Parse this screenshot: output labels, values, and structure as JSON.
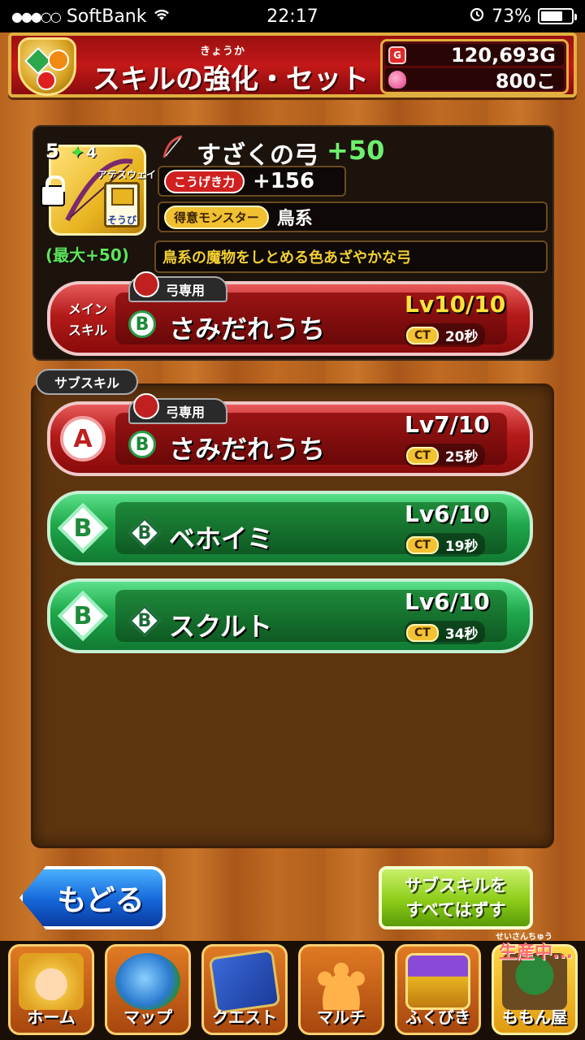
{
  "status_bar": {
    "carrier": "SoftBank",
    "time": "22:17",
    "battery": "73%",
    "battery_level": 0.73
  },
  "header": {
    "title": "スキルの強化・セット",
    "ruby": "きょうか",
    "gold": "120,693G",
    "gold_icon": "G",
    "gems": "800こ"
  },
  "item": {
    "rarity": "5",
    "plus_count": "4",
    "character": "アテスウェイ",
    "equip_label": "そうび",
    "max_plus": "(最大+50)",
    "name": "すざくの弓",
    "plus": "+50",
    "attack_label": "こうげき力",
    "attack_value": "+156",
    "monster_label": "得意モンスター",
    "monster_value": "鳥系",
    "description": "鳥系の魔物をしとめる色あざやかな弓"
  },
  "main_skill": {
    "slot_label_1": "メイン",
    "slot_label_2": "スキル",
    "tag": "弓専用",
    "rank": "B",
    "name": "さみだれうち",
    "level": "Lv10/10",
    "ct_label": "CT",
    "ct_value": "20秒"
  },
  "sub_skills": {
    "label": "サブスキル",
    "items": [
      {
        "slot": "A",
        "tag": "弓専用",
        "rank": "B",
        "name": "さみだれうち",
        "level": "Lv7/10",
        "ct_label": "CT",
        "ct_value": "25秒",
        "color": "red"
      },
      {
        "slot": "B",
        "tag": "",
        "rank": "B",
        "name": "ベホイミ",
        "level": "Lv6/10",
        "ct_label": "CT",
        "ct_value": "19秒",
        "color": "green"
      },
      {
        "slot": "B",
        "tag": "",
        "rank": "B",
        "name": "スクルト",
        "level": "Lv6/10",
        "ct_label": "CT",
        "ct_value": "34秒",
        "color": "green"
      }
    ]
  },
  "buttons": {
    "back": "もどる",
    "remove_all_line1": "サブスキルを",
    "remove_all_line2": "すべてはずす"
  },
  "tabs": [
    {
      "label": "ホーム",
      "icon": "hero-face-icon"
    },
    {
      "label": "マップ",
      "icon": "globe-icon"
    },
    {
      "label": "クエスト",
      "icon": "book-icon"
    },
    {
      "label": "マルチ",
      "icon": "people-icon"
    },
    {
      "label": "ふくびき",
      "icon": "treasure-chest-icon"
    },
    {
      "label": "ももん屋",
      "icon": "shop-icon"
    }
  ],
  "production": {
    "ruby": "せいさんちゅう",
    "label": "生産中..."
  },
  "colors": {
    "header_red": "#c41818",
    "gold_border": "#e0b040",
    "skill_red": "#b41a1a",
    "skill_green": "#1ea84a",
    "plus_green": "#6ef06e",
    "desc_yellow": "#f3d032"
  }
}
